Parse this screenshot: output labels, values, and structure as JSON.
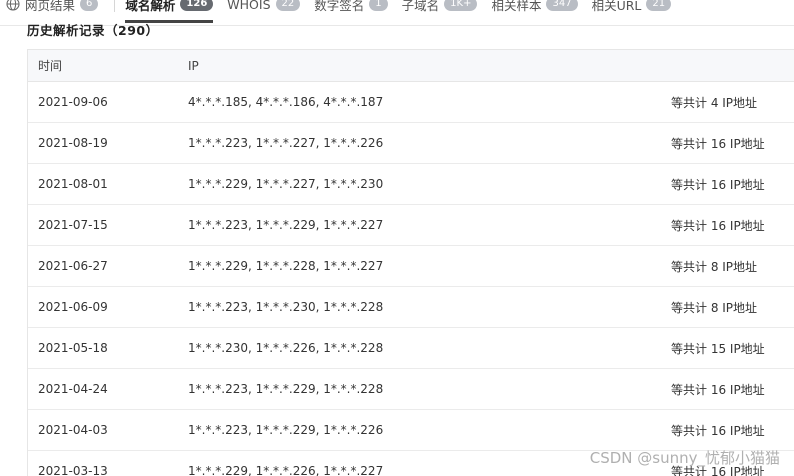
{
  "tabs": [
    {
      "label": "网页结果",
      "count": "6"
    },
    {
      "label": "域名解析",
      "count": "126"
    },
    {
      "label": "WHOIS",
      "count": "22"
    },
    {
      "label": "数字签名",
      "count": "1"
    },
    {
      "label": "子域名",
      "count": "1K+"
    },
    {
      "label": "相关样本",
      "count": "347"
    },
    {
      "label": "相关URL",
      "count": "21"
    }
  ],
  "section": {
    "title": "历史解析记录（290）"
  },
  "table": {
    "headers": {
      "time": "时间",
      "ip": "IP"
    },
    "rows": [
      {
        "time": "2021-09-06",
        "ip": "4*.*.*.185, 4*.*.*.186, 4*.*.*.187",
        "total": "等共计 4 IP地址"
      },
      {
        "time": "2021-08-19",
        "ip": "1*.*.*.223, 1*.*.*.227, 1*.*.*.226",
        "total": "等共计 16 IP地址"
      },
      {
        "time": "2021-08-01",
        "ip": "1*.*.*.229, 1*.*.*.227, 1*.*.*.230",
        "total": "等共计 16 IP地址"
      },
      {
        "time": "2021-07-15",
        "ip": "1*.*.*.223, 1*.*.*.229, 1*.*.*.227",
        "total": "等共计 16 IP地址"
      },
      {
        "time": "2021-06-27",
        "ip": "1*.*.*.229, 1*.*.*.228, 1*.*.*.227",
        "total": "等共计 8 IP地址"
      },
      {
        "time": "2021-06-09",
        "ip": "1*.*.*.223, 1*.*.*.230, 1*.*.*.228",
        "total": "等共计 8 IP地址"
      },
      {
        "time": "2021-05-18",
        "ip": "1*.*.*.230, 1*.*.*.226, 1*.*.*.228",
        "total": "等共计 15 IP地址"
      },
      {
        "time": "2021-04-24",
        "ip": "1*.*.*.223, 1*.*.*.229, 1*.*.*.228",
        "total": "等共计 16 IP地址"
      },
      {
        "time": "2021-04-03",
        "ip": "1*.*.*.223, 1*.*.*.229, 1*.*.*.226",
        "total": "等共计 16 IP地址"
      },
      {
        "time": "2021-03-13",
        "ip": "1*.*.*.229, 1*.*.*.226, 1*.*.*.227",
        "total": "等共计 16 IP地址"
      }
    ]
  },
  "watermark": "CSDN @sunny_忧郁小猫猫",
  "icons": {
    "web_results": "globe-icon"
  },
  "colors": {
    "active_badge": "#666a70",
    "inactive_badge": "#b9bdc4",
    "active_underline": "#444444",
    "header_bg": "#f7f8fa"
  }
}
